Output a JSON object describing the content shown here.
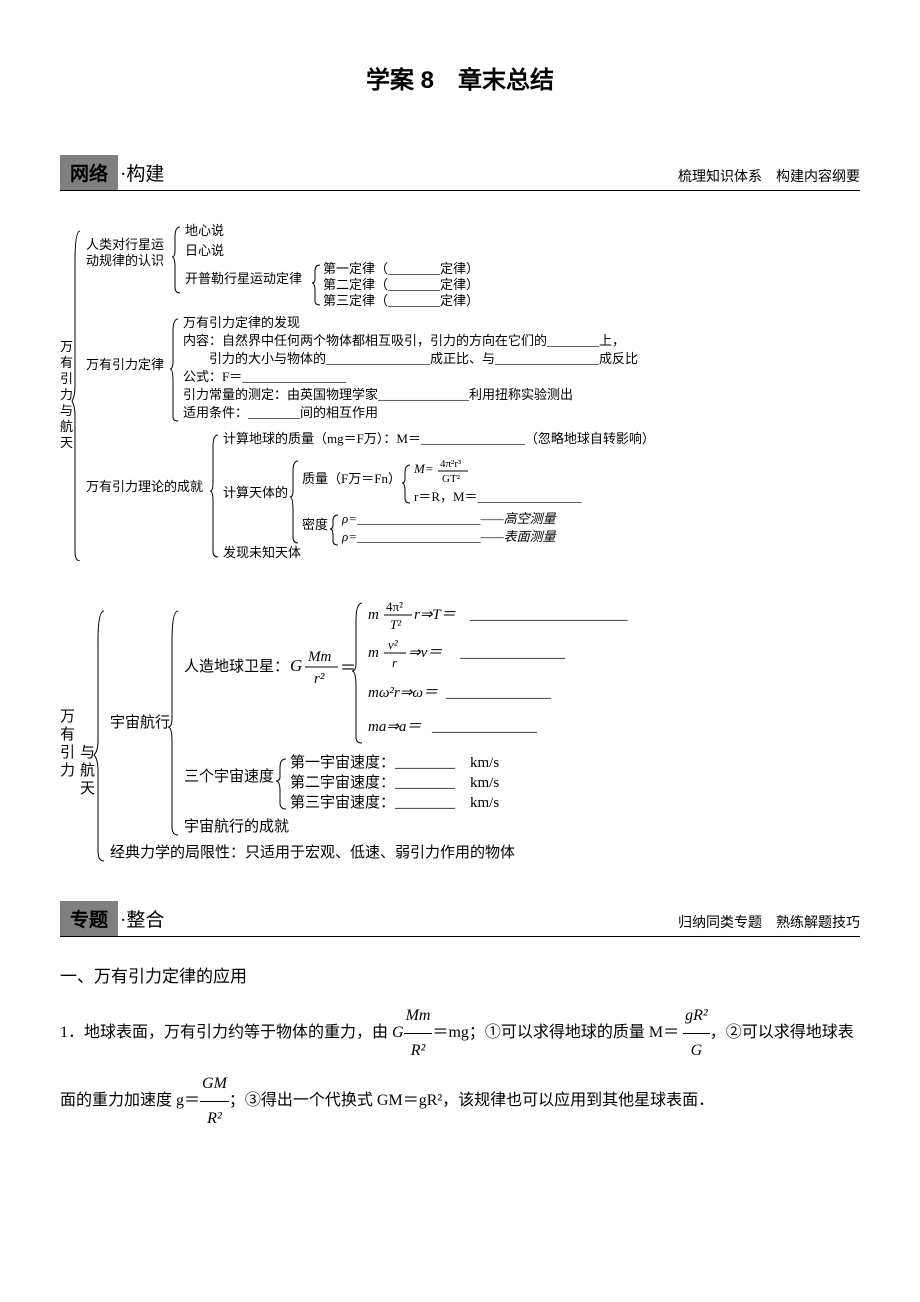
{
  "title": "学案 8　章末总结",
  "banner1": {
    "tag": "网络",
    "label": "·构建",
    "sub": "梳理知识体系　构建内容纲要"
  },
  "banner2": {
    "tag": "专题",
    "label": "·整合",
    "sub": "归纳同类专题　熟练解题技巧"
  },
  "tree1": {
    "root_vert": "万有引力与航天",
    "r1": "人类对行星运动规律的认识",
    "r1a": "地心说",
    "r1b": "日心说",
    "r1c": "开普勒行星运动定律",
    "r1c1": "第一定律（________定律）",
    "r1c2": "第二定律（________定律）",
    "r1c3": "第三定律（________定律）",
    "r2": "万有引力定律",
    "r2a": "万有引力定律的发现",
    "r2b1": "内容：自然界中任何两个物体都相互吸引，引力的方向在它们的________上，",
    "r2b2": "　　引力的大小与物体的________________成正比、与________________成反比",
    "r2c": "公式：F＝________________",
    "r2d": "引力常量的测定：由英国物理学家______________利用扭称实验测出",
    "r2e": "适用条件：________间的相互作用",
    "r3": "万有引力理论的成就",
    "r3a": "计算地球的质量（mg＝F万）：M＝________________（忽略地球自转影响）",
    "r3b": "计算天体的",
    "r3b_mass": "质量（F万＝Fn）",
    "r3b_m1a": "M＝",
    "r3b_m1b": "4π²r³",
    "r3b_m1c": "GT²",
    "r3b_m2": "r＝R，M＝________________",
    "r3b_den": "密度",
    "r3b_d1": "ρ=___________________——高空测量",
    "r3b_d2": "ρ=___________________——表面测量",
    "r3c": "发现未知天体"
  },
  "tree2": {
    "root_vert": "万有引力与航天",
    "a": "宇宙航行",
    "a1": "人造地球卫星：",
    "a1_eq_left_num": "Mm",
    "a1_eq_left_den": "r²",
    "a1_eq_G": "G",
    "a1_eq_eq": "＝",
    "eq1_l1": "m",
    "eq1_frac_n": "4π²",
    "eq1_frac_d": "T²",
    "eq1_l2": "r⇒T＝",
    "eq1_blank": "_____________________",
    "eq2_l1": "m",
    "eq2_frac_n": "v²",
    "eq2_frac_d": "r",
    "eq2_l2": "⇒v＝",
    "eq2_blank": "______________",
    "eq3": "mω²r⇒ω＝",
    "eq3_blank": "______________",
    "eq4": "ma⇒a＝",
    "eq4_blank": "______________",
    "a2": "三个宇宙速度",
    "a2a": "第一宇宙速度：________　km/s",
    "a2b": "第二宇宙速度：________　km/s",
    "a2c": "第三宇宙速度：________　km/s",
    "a3": "宇宙航行的成就",
    "b": "经典力学的局限性：只适用于宏观、低速、弱引力作用的物体"
  },
  "body": {
    "h2": "一、万有引力定律的应用",
    "p1a": "1．地球表面，万有引力约等于物体的重力，由 ",
    "p1_G": "G",
    "p1_num": "Mm",
    "p1_den": "R²",
    "p1b": "＝mg；①可以求得地球的质量 M＝",
    "p1_num2": "gR²",
    "p1_den2": "G",
    "p1c": "，②可以求得地球表面的重力加速度 g＝",
    "p1_num3": "GM",
    "p1_den3": "R²",
    "p1d": "；③得出一个代换式 GM＝gR²，该规律也可以应用到其他星球表面．"
  }
}
